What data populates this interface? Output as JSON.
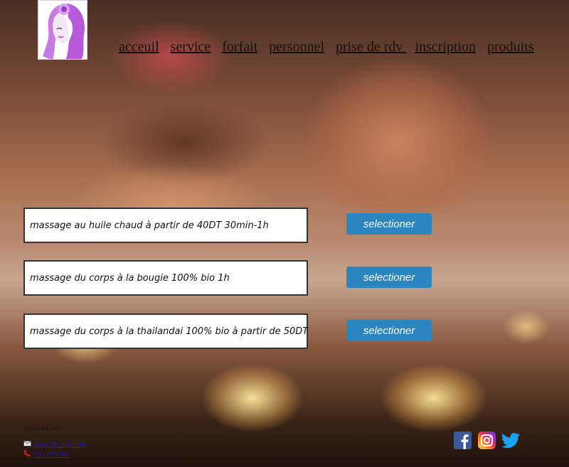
{
  "header": {
    "nav": [
      {
        "label": "acceuil"
      },
      {
        "label": "service"
      },
      {
        "label": "forfait"
      },
      {
        "label": "personnel"
      },
      {
        "label": "prise de rdv "
      },
      {
        "label": "inscription"
      },
      {
        "label": "produits"
      }
    ]
  },
  "offers": [
    {
      "text": "massage au huile chaud à partir de 40DT 30min-1h",
      "button": "selectioner"
    },
    {
      "text": "massage du corps à la bougie 100% bio 1h",
      "button": "selectioner"
    },
    {
      "text": "massage du corps à la thailandai 100% bio à partir de 50DT",
      "button": "selectioner"
    }
  ],
  "footer": {
    "contact_title": "Contactez nous",
    "email": "spaaa_flr_ex@.com",
    "phone": "(31) 373-2363",
    "social": [
      "facebook-icon",
      "instagram-icon",
      "twitter-icon"
    ]
  },
  "colors": {
    "button": "#2b86c0",
    "facebook": "#3b5998",
    "twitter": "#1da1f2"
  }
}
